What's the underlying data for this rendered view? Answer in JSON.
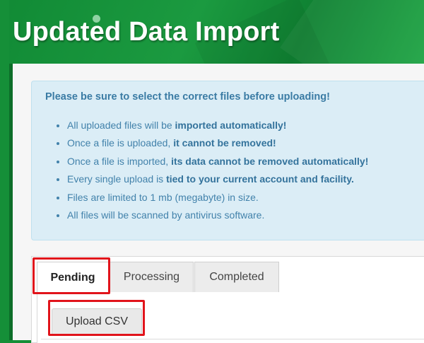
{
  "header": {
    "title": "Updated Data Import"
  },
  "notice": {
    "heading": "Please be sure to select the correct files before uploading!",
    "items": [
      {
        "text": "All uploaded files will be ",
        "bold": "imported automatically!"
      },
      {
        "text": "Once a file is uploaded, ",
        "bold": "it cannot be removed!"
      },
      {
        "text": "Once a file is imported, ",
        "bold": "its data cannot be removed automatically!"
      },
      {
        "text": "Every single upload is ",
        "bold": "tied to your current account and facility."
      },
      {
        "text": "Files are limited to 1 mb (megabyte) in size.",
        "bold": ""
      },
      {
        "text": "All files will be scanned by antivirus software.",
        "bold": ""
      }
    ]
  },
  "tabs": [
    {
      "label": "Pending",
      "active": true
    },
    {
      "label": "Processing",
      "active": false
    },
    {
      "label": "Completed",
      "active": false
    }
  ],
  "actions": {
    "upload_label": "Upload CSV"
  },
  "colors": {
    "header_green": "#1b9a40",
    "alert_bg": "#dbedf6",
    "alert_text": "#3a7ba4",
    "highlight_red": "#e1141b"
  }
}
